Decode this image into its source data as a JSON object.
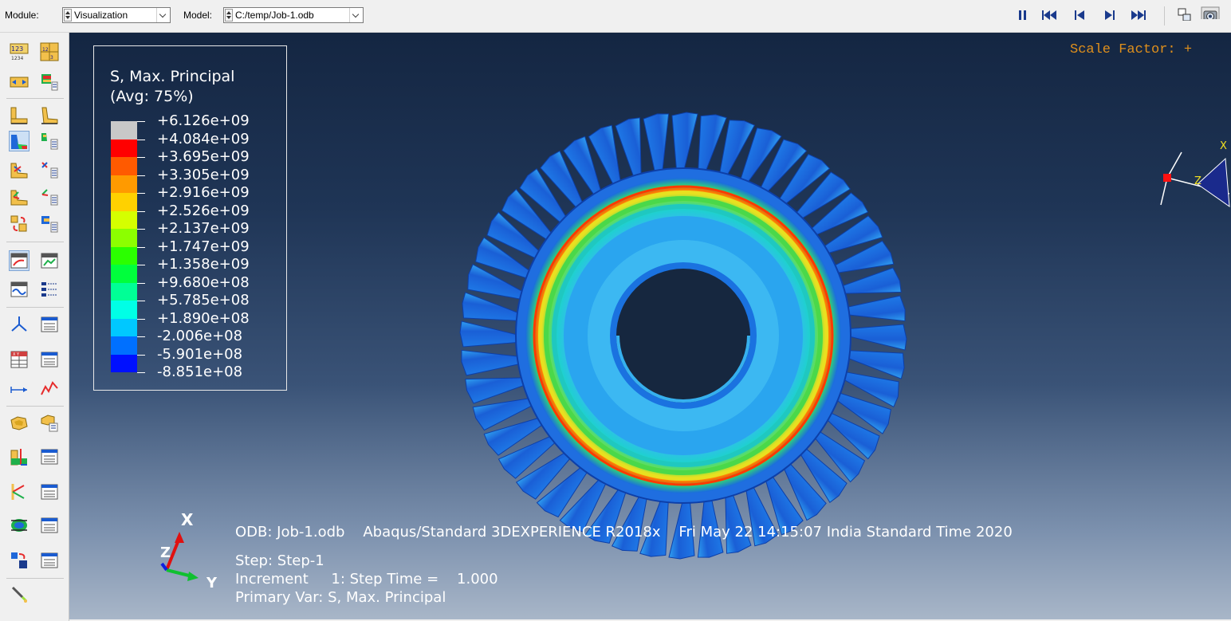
{
  "toolbar": {
    "module_label": "Module:",
    "module_value": "Visualization",
    "model_label": "Model:",
    "model_value": "C:/temp/Job-1.odb"
  },
  "legend": {
    "title": "S, Max. Principal\n(Avg: 75%)",
    "entries": [
      {
        "value": "+6.126e+09",
        "color": "#c8c8c8"
      },
      {
        "value": "+4.084e+09",
        "color": "#ff0000"
      },
      {
        "value": "+3.695e+09",
        "color": "#ff5a00"
      },
      {
        "value": "+3.305e+09",
        "color": "#ff9a00"
      },
      {
        "value": "+2.916e+09",
        "color": "#ffd100"
      },
      {
        "value": "+2.526e+09",
        "color": "#d5ff00"
      },
      {
        "value": "+2.137e+09",
        "color": "#8cff00"
      },
      {
        "value": "+1.747e+09",
        "color": "#2bff00"
      },
      {
        "value": "+1.358e+09",
        "color": "#00ff3c"
      },
      {
        "value": "+9.680e+08",
        "color": "#00ff96"
      },
      {
        "value": "+5.785e+08",
        "color": "#00ffe6"
      },
      {
        "value": "+1.890e+08",
        "color": "#00c8ff"
      },
      {
        "value": "-2.006e+08",
        "color": "#0070ff"
      },
      {
        "value": "-5.901e+08",
        "color": "#0010ff"
      },
      {
        "value": "-8.851e+08",
        "color": "#404040"
      }
    ],
    "last_value": "-8.851e+08"
  },
  "viewport": {
    "scale_factor": "Scale Factor: +",
    "odb_line": "ODB: Job-1.odb    Abaqus/Standard 3DEXPERIENCE R2018x    Fri May 22 14:15:07 India Standard Time 2020",
    "step_line": "Step: Step-1",
    "increment_line": "Increment     1: Step Time =    1.000",
    "primary_line": "Primary Var: S, Max. Principal"
  },
  "triad": {
    "x": "X",
    "y": "Y",
    "z": "Z"
  },
  "view_triad": {
    "x": "X",
    "z": "Z"
  },
  "icons": [
    "pause-icon",
    "first-frame-icon",
    "previous-frame-icon",
    "next-frame-icon",
    "last-frame-icon",
    "frame-layout-icon",
    "camera-icon"
  ]
}
